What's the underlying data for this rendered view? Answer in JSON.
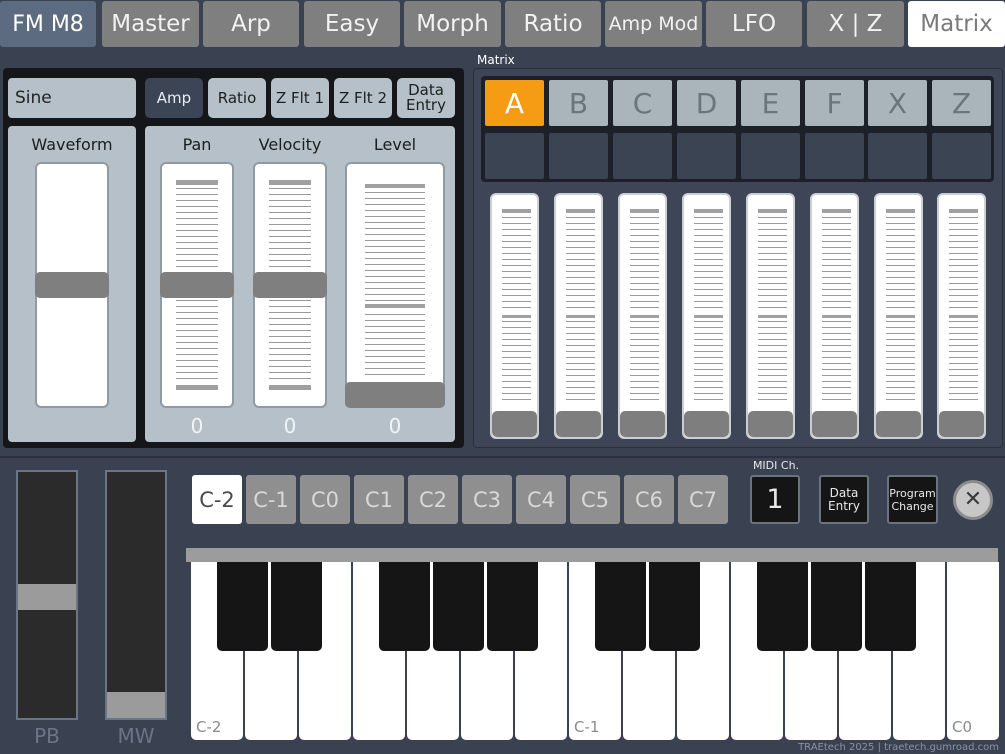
{
  "tabs": {
    "brand": "FM M8",
    "items": [
      "Master",
      "Arp",
      "Easy",
      "Morph",
      "Ratio",
      "Amp Mod",
      "LFO",
      "X | Z",
      "Matrix"
    ],
    "active": "Matrix"
  },
  "osc_panel": {
    "waveform_name": "Sine",
    "mod_buttons": [
      "Amp",
      "Ratio",
      "Z Flt 1",
      "Z Flt 2",
      "Data Entry"
    ],
    "active_button": "Amp",
    "waveform_label": "Waveform",
    "pan_label": "Pan",
    "velocity_label": "Velocity",
    "level_label": "Level",
    "pan_value": "0",
    "velocity_value": "0",
    "level_value": "0"
  },
  "matrix": {
    "title": "Matrix",
    "tabs": [
      "A",
      "B",
      "C",
      "D",
      "E",
      "F",
      "X",
      "Z"
    ],
    "active_tab": "A",
    "slider_levels": [
      0,
      0,
      0,
      0,
      0,
      0,
      0,
      0
    ]
  },
  "keyboard": {
    "octaves": [
      "C-2",
      "C-1",
      "C0",
      "C1",
      "C2",
      "C3",
      "C4",
      "C5",
      "C6",
      "C7"
    ],
    "active_octave": "C-2",
    "midi_ch_label": "MIDI Ch.",
    "midi_ch_value": "1",
    "data_entry_label": "Data Entry",
    "program_change_label": "Program Change",
    "pb_label": "PB",
    "mw_label": "MW",
    "key_labels": {
      "c_minus2": "C-2",
      "c_minus1": "C-1",
      "c0": "C0"
    },
    "pitch_bend_level": 0.5,
    "mod_wheel_level": 0
  },
  "footer": {
    "credit": "TRAEtech 2025 | traetech.gumroad.com"
  },
  "colors": {
    "accent": "#f59b14",
    "panel_bg": "#3a4252",
    "sub_panel": "#b5c0c8"
  }
}
